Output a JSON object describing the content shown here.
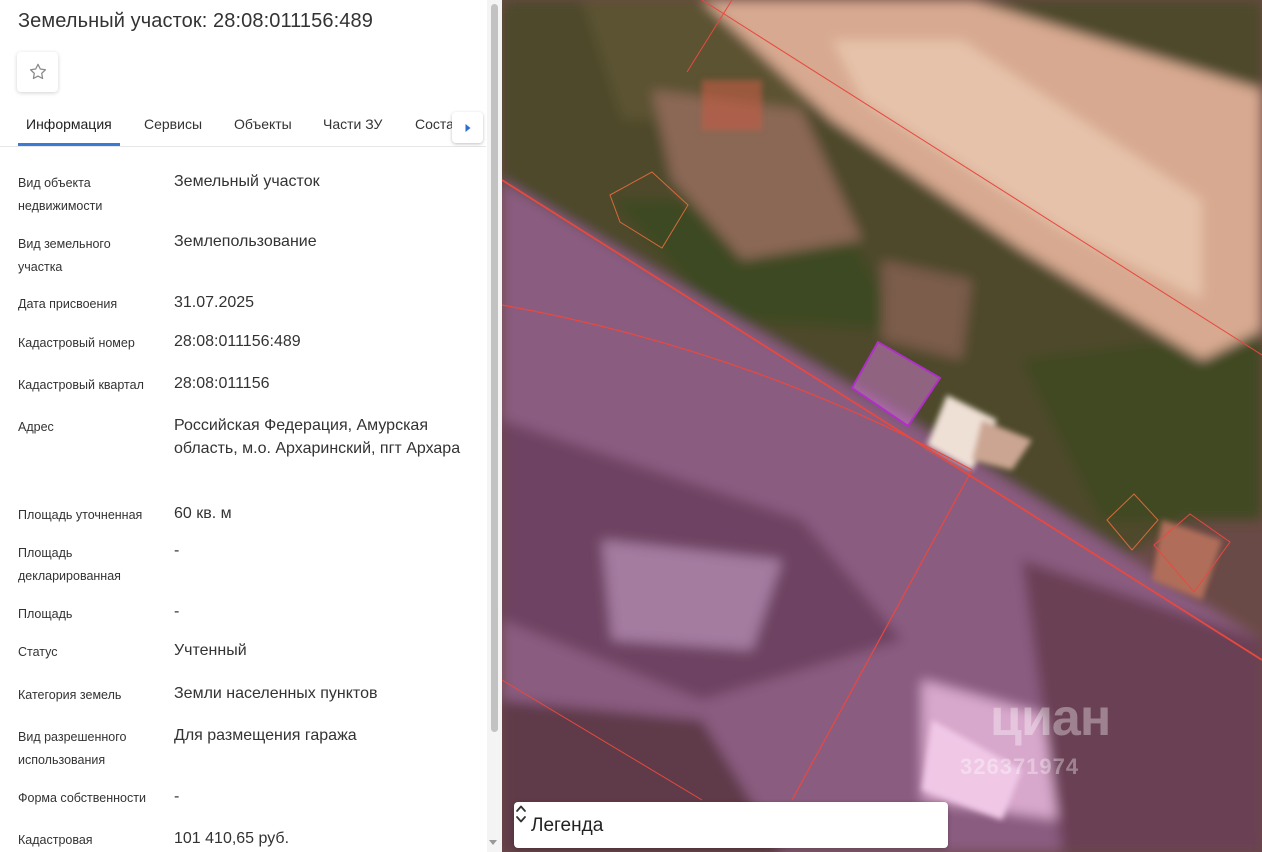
{
  "panel": {
    "title": "Земельный участок: 28:08:011156:489",
    "favorite_icon": "star-outline-icon",
    "tabs": [
      {
        "label": "Информация",
        "active": true
      },
      {
        "label": "Сервисы",
        "active": false
      },
      {
        "label": "Объекты",
        "active": false
      },
      {
        "label": "Части ЗУ",
        "active": false
      },
      {
        "label": "Состав",
        "active": false
      }
    ],
    "tabs_next_icon": "chevron-right-icon",
    "rows": [
      {
        "label": "Вид объекта недвижимости",
        "value": "Земельный участок"
      },
      {
        "label": "Вид земельного участка",
        "value": "Землепользование"
      },
      {
        "label": "Дата присвоения",
        "value": "31.07.2025"
      },
      {
        "label": "Кадастровый номер",
        "value": "28:08:011156:489"
      },
      {
        "label": "Кадастровый квартал",
        "value": "28:08:011156"
      },
      {
        "label": "Адрес",
        "value": "Российская Федерация, Амурская область, м.о. Архаринский, пгт Архара"
      },
      {
        "label": "Площадь уточненная",
        "value": "60 кв. м"
      },
      {
        "label": "Площадь декларированная",
        "value": "-"
      },
      {
        "label": "Площадь",
        "value": "-"
      },
      {
        "label": "Статус",
        "value": "Учтенный"
      },
      {
        "label": "Категория земель",
        "value": "Земли населенных пунктов"
      },
      {
        "label": "Вид разрешенного использования",
        "value": "Для размещения гаража"
      },
      {
        "label": "Форма собственности",
        "value": "-"
      },
      {
        "label": "Кадастровая",
        "value": "101 410,65 руб."
      }
    ]
  },
  "map": {
    "watermark_text": "циан",
    "watermark_number": "326371974",
    "legend_label": "Легенда",
    "legend_toggle_icon": "chevron-up-down-icon",
    "colors": {
      "parcel_border": "#e8493f",
      "selected_parcel": "#b02fc8"
    }
  }
}
